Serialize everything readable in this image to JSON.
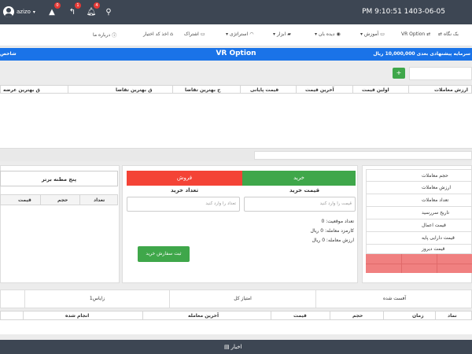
{
  "topbar": {
    "username": "azizo",
    "clock": "PM 9:10:51 1403-06-05",
    "alerts_badge": "0",
    "tools_badge": "1",
    "bell_badge": "4"
  },
  "navbar": {
    "items": [
      {
        "label": "بک نگاه",
        "icon": "swap-icon"
      },
      {
        "label": "VR Option",
        "icon": "swap-icon"
      },
      {
        "label": "آموزش",
        "icon": "monitor-icon"
      },
      {
        "label": "دیده بان",
        "icon": "eye-icon"
      },
      {
        "label": "ابزار",
        "icon": "briefcase-icon"
      },
      {
        "label": "استراتژی",
        "icon": "wifi-icon"
      },
      {
        "label": "اشتراک",
        "icon": "card-icon"
      },
      {
        "label": "اخذ کد اختیار",
        "icon": "tag-icon"
      },
      {
        "label": "درباره ما",
        "icon": "info-icon"
      }
    ]
  },
  "banner": {
    "title": "VR Option",
    "capital": "سرمایه پیشنهادی بعدی 10,000,000 ریال",
    "left_text": "شاخص"
  },
  "add_button": "+",
  "option_table": {
    "columns": [
      "ارزش معاملات",
      "اولین قیمت",
      "آخرین قیمت",
      "قیمت پایانی",
      "ح بهترین تقاضا",
      "ق بهترین تقاضا",
      "ق بهترین عرضه"
    ]
  },
  "info_panel": {
    "rows": [
      "حجم معاملات",
      "ارزش معاملات",
      "تعداد معاملات",
      "تاریخ سررسید",
      "قیمت اعمال",
      "قیمت دارایی پایه",
      "قیمت دیروز"
    ]
  },
  "order_form": {
    "buy_tab": "خرید",
    "sell_tab": "فروش",
    "price_label": "قیمت خرید",
    "qty_label": "تعداد خرید",
    "price_placeholder": "قیمت را وارد کنید",
    "qty_placeholder": "تعداد را وارد کنید",
    "position_count": "تعداد موقعیت: 0",
    "commission": "کارمزد معامله: 0 ریال",
    "trade_value": "ارزش معامله: 0 ریال",
    "submit": "ثبت سفارش خرید"
  },
  "depth_panel": {
    "title": "پنج مظنه برتر",
    "columns": [
      "تعداد",
      "حجم",
      "قیمت"
    ]
  },
  "bottom_tabs": {
    "tabs": [
      "آفست شده",
      "امتیاز کل",
      "زایاس1"
    ]
  },
  "trades_table": {
    "columns": [
      "نماد",
      "زمان",
      "حجم",
      "قیمت",
      "آخرین معامله",
      "انجام شده"
    ]
  },
  "footer": {
    "label": "اخبار"
  }
}
